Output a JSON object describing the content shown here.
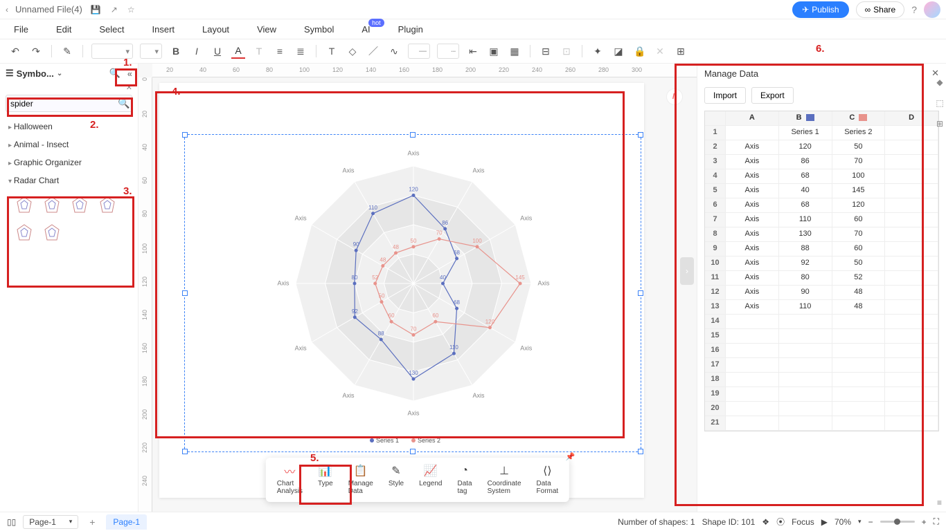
{
  "title_bar": {
    "filename": "Unnamed File(4)",
    "publish": "Publish",
    "share": "Share"
  },
  "menu": {
    "file": "File",
    "edit": "Edit",
    "select": "Select",
    "insert": "Insert",
    "layout": "Layout",
    "view": "View",
    "symbol": "Symbol",
    "ai": "AI",
    "ai_badge": "hot",
    "plugin": "Plugin"
  },
  "left": {
    "title": "Symbo...",
    "search_value": "spider",
    "categories": {
      "halloween": "Halloween",
      "animal": "Animal - Insect",
      "graphic": "Graphic Organizer",
      "radar": "Radar Chart"
    }
  },
  "chart_toolbar": {
    "analysis": "Chart Analysis",
    "type": "Type",
    "manage": "Manage Data",
    "style": "Style",
    "legend": "Legend",
    "datatag": "Data tag",
    "coord": "Coordinate System",
    "format": "Data Format"
  },
  "right": {
    "title": "Manage Data",
    "import": "Import",
    "export": "Export",
    "col_a": "A",
    "col_b": "B",
    "col_c": "C",
    "col_d": "D",
    "series1": "Series 1",
    "series2": "Series 2",
    "axis_label": "Axis"
  },
  "status": {
    "page_name": "Page-1",
    "page_tab": "Page-1",
    "shapes": "Number of shapes: 1",
    "shape_id": "Shape ID: 101",
    "focus": "Focus",
    "zoom": "70%"
  },
  "ruler_h": [
    "20",
    "40",
    "60",
    "80",
    "100",
    "120",
    "140",
    "160",
    "180",
    "200",
    "220",
    "240",
    "260",
    "280",
    "300"
  ],
  "ruler_v": [
    "0",
    "20",
    "40",
    "60",
    "80",
    "100",
    "120",
    "140",
    "160",
    "180",
    "200",
    "220",
    "240"
  ],
  "annotations": {
    "a1": "1.",
    "a2": "2.",
    "a3": "3.",
    "a4": "4.",
    "a5": "5.",
    "a6": "6."
  },
  "chart_data": {
    "type": "radar",
    "axes": [
      "Axis",
      "Axis",
      "Axis",
      "Axis",
      "Axis",
      "Axis",
      "Axis",
      "Axis",
      "Axis",
      "Axis",
      "Axis",
      "Axis"
    ],
    "series": [
      {
        "name": "Series 1",
        "color": "#5b6fbf",
        "values": [
          120,
          86,
          68,
          40,
          68,
          110,
          130,
          88,
          92,
          80,
          90,
          110
        ]
      },
      {
        "name": "Series 2",
        "color": "#e8938c",
        "values": [
          50,
          70,
          100,
          145,
          120,
          60,
          70,
          60,
          50,
          52,
          48,
          48
        ]
      }
    ],
    "rings": [
      40,
      80,
      120,
      160
    ],
    "max": 160
  }
}
